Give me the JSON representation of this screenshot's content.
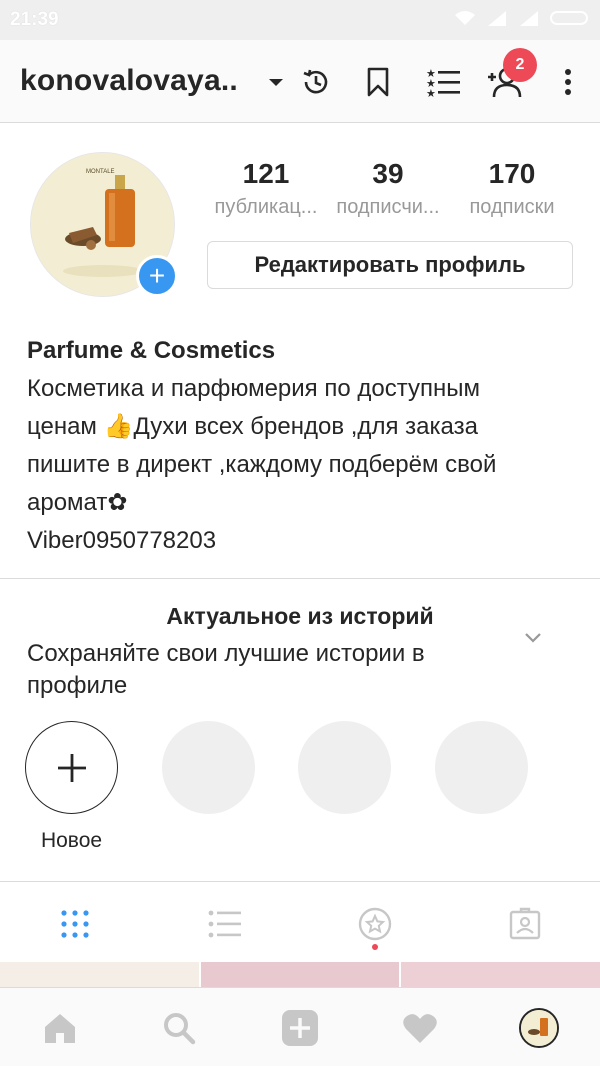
{
  "status_bar": {
    "time": "21:39"
  },
  "header": {
    "username": "konovalovaya..",
    "notification_count": "2",
    "icons": [
      "chevron-down-icon",
      "archive-history-icon",
      "bookmark-icon",
      "close-friends-list-icon",
      "discover-people-icon",
      "more-options-icon"
    ]
  },
  "profile": {
    "avatar_label": "MONTALE",
    "stats": [
      {
        "value": "121",
        "label": "публикац..."
      },
      {
        "value": "39",
        "label": "подписчи..."
      },
      {
        "value": "170",
        "label": "подписки"
      }
    ],
    "edit_button": "Редактировать профиль",
    "name": "Parfume & Cosmetics",
    "bio_lines": [
      "Косметика и парфюмерия по доступным",
      "ценам 👍Духи всех брендов ,для заказа",
      "пишите в директ ,каждому подберём свой",
      "аромат✿",
      "Viber0950778203"
    ]
  },
  "highlights": {
    "title": "Актуальное из историй",
    "subtitle": "Сохраняйте свои лучшие истории в профиле",
    "new_label": "Новое"
  },
  "tabs": [
    "grid-icon",
    "list-icon",
    "saved-star-icon",
    "tagged-icon"
  ],
  "bottom_nav": [
    "home-icon",
    "search-icon",
    "add-post-icon",
    "activity-heart-icon",
    "profile-avatar"
  ],
  "colors": {
    "accent_blue": "#3897f0",
    "badge_red": "#ed4956",
    "text": "#262626",
    "muted": "#999999",
    "icon_gray": "#c7c7c7"
  }
}
